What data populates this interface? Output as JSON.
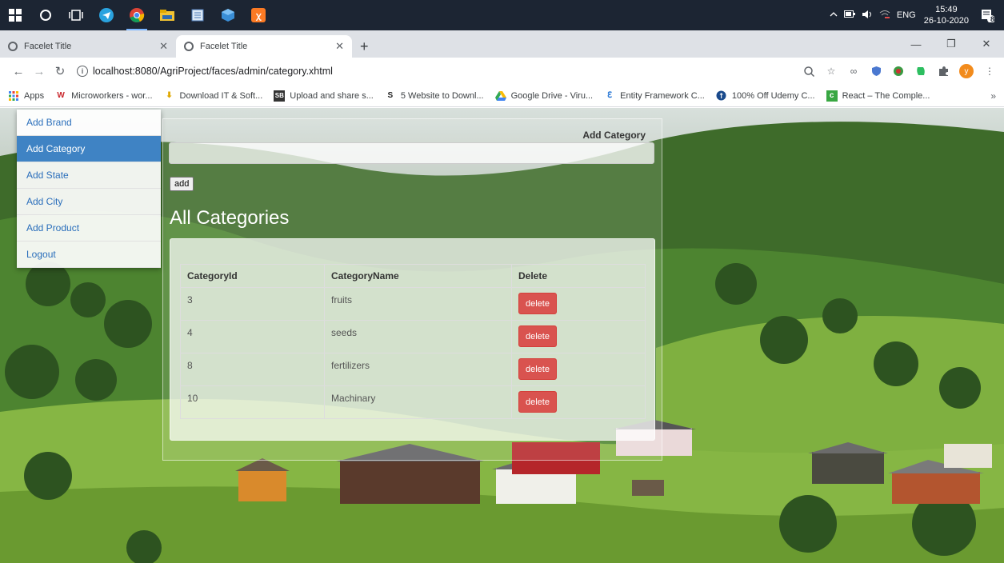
{
  "taskbar": {
    "time": "15:49",
    "date": "26-10-2020",
    "lang": "ENG",
    "notification_count": "8"
  },
  "tabs": [
    {
      "title": "Facelet Title",
      "active": false
    },
    {
      "title": "Facelet Title",
      "active": true
    }
  ],
  "address": {
    "url": "localhost:8080/AgriProject/faces/admin/category.xhtml"
  },
  "bookmarks": [
    {
      "label": "Apps",
      "icon": "apps-grid-icon"
    },
    {
      "label": "Microworkers - wor...",
      "icon": "microworkers-icon"
    },
    {
      "label": "Download IT & Soft...",
      "icon": "download-icon"
    },
    {
      "label": "Upload and share s...",
      "icon": "sb-icon"
    },
    {
      "label": "5 Website to Downl...",
      "icon": "five-icon"
    },
    {
      "label": "Google Drive - Viru...",
      "icon": "drive-icon"
    },
    {
      "label": "Entity Framework C...",
      "icon": "ef-icon"
    },
    {
      "label": "100% Off Udemy C...",
      "icon": "udemy-icon"
    },
    {
      "label": "React – The Comple...",
      "icon": "react-icon"
    }
  ],
  "sidebar": {
    "items": [
      {
        "label": "Add Brand"
      },
      {
        "label": "Add Category"
      },
      {
        "label": "Add State"
      },
      {
        "label": "Add City"
      },
      {
        "label": "Add Product"
      },
      {
        "label": "Logout"
      }
    ]
  },
  "form": {
    "label": "Add Category",
    "input_value": "",
    "add_label": "add"
  },
  "table": {
    "title": "All Categories",
    "headers": [
      "CategoryId",
      "CategoryName",
      "Delete"
    ],
    "rows": [
      {
        "id": "3",
        "name": "fruits",
        "action": "delete"
      },
      {
        "id": "4",
        "name": "seeds",
        "action": "delete"
      },
      {
        "id": "8",
        "name": "fertilizers",
        "action": "delete"
      },
      {
        "id": "10",
        "name": "Machinary",
        "action": "delete"
      }
    ]
  },
  "colors": {
    "menu_active": "#3f83c4",
    "delete_button": "#d9534f",
    "taskbar": "#1c2533"
  }
}
